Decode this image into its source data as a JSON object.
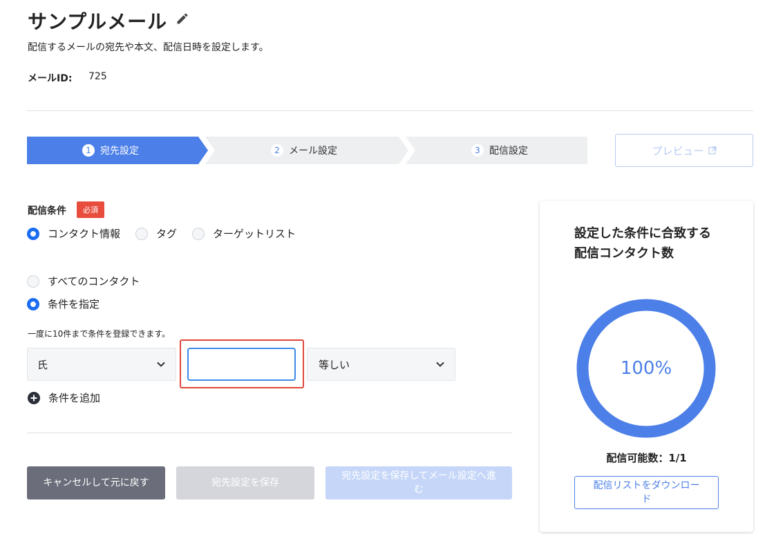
{
  "header": {
    "title": "サンプルメール",
    "subtitle": "配信するメールの宛先や本文、配信日時を設定します。",
    "mail_id_label": "メールID:",
    "mail_id_value": "725"
  },
  "steps": [
    {
      "num": "1",
      "label": "宛先設定",
      "active": true
    },
    {
      "num": "2",
      "label": "メール設定",
      "active": false
    },
    {
      "num": "3",
      "label": "配信設定",
      "active": false
    }
  ],
  "preview_button": "プレビュー",
  "condition": {
    "label": "配信条件",
    "required_badge": "必須",
    "type_options": [
      "コンタクト情報",
      "タグ",
      "ターゲットリスト"
    ],
    "type_selected": "コンタクト情報",
    "scope_options": [
      "すべてのコンタクト",
      "条件を指定"
    ],
    "scope_selected": "条件を指定",
    "hint": "一度に10件まで条件を登録できます。",
    "field_select": "氏",
    "value_input": "",
    "operator_select": "等しい",
    "add_label": "条件を追加"
  },
  "buttons": {
    "cancel": "キャンセルして元に戻す",
    "save": "宛先設定を保存",
    "save_next": "宛先設定を保存してメール設定へ進む"
  },
  "summary": {
    "title": "設定した条件に合致する配信コンタクト数",
    "percent_label": "100%",
    "percent_value": 100,
    "count_label": "配信可能数：1/1",
    "download_button": "配信リストをダウンロード"
  },
  "colors": {
    "accent": "#4c7fe8",
    "radio_on": "#1a6cf0",
    "required": "#e84c3d",
    "highlight": "#e0453a"
  },
  "icons": [
    "pencil-icon",
    "external-link-icon",
    "chevron-down-icon",
    "plus-circle-icon"
  ]
}
